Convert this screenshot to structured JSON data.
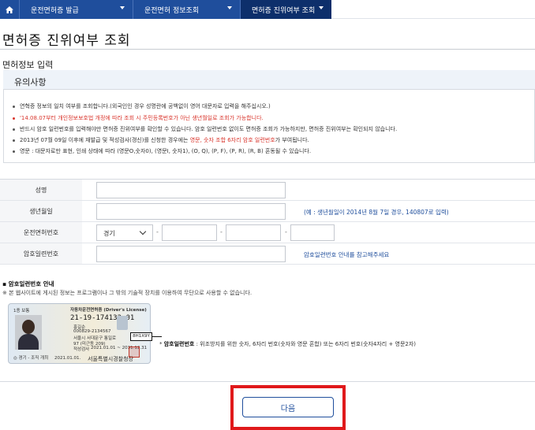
{
  "nav": {
    "items": [
      {
        "label": "운전면허증 발급"
      },
      {
        "label": "운전면허 정보조회"
      },
      {
        "label": "면허증 진위여부 조회"
      }
    ]
  },
  "page": {
    "title": "면허증 진위여부 조회",
    "section": "면허정보 입력"
  },
  "notice": {
    "heading": "유의사항",
    "lines": [
      "연혁증 정보의 일치 여부를 조회합니다.(외국인인 경우 성명란에 공백없이 영어 대문자로 입력을 해주십시오.)",
      "'14.08.07부터 개인정보보호법 개정에 따라 조회 시 주민등록번호가 아닌 생년월일로 조회가 가능합니다.",
      "반드시 암호 일련번호를 입력해야만 면허증 진위여부를 확인할 수 있습니다. 암호 일련번호 없이도 면허증 조회가 가능하지만, 면허증 진위여부는 확인되지 않습니다.",
      "2013년 07월 09일 이후에 재발급 및 적성검사(갱신)를 신청한 경우에는 ",
      "영문, 숫자 조합 6자리 암호 일련번호",
      "가 부여됩니다.",
      "영문 : 대문자로만 표현, 인쇄 상태에 따라 (영문O,숫자0), (영문I, 숫자1), (O, Q), (P, F), (P, R), (R, B) 혼동될 수 있습니다."
    ]
  },
  "form": {
    "name_label": "성명",
    "birth_label": "생년월일",
    "birth_hint": "(예 : 생년월일이 2014년 8월 7일 경우, 140807로 입력)",
    "license_label": "운전면허번호",
    "region_selected": "경기",
    "serial_label": "암호일련번호",
    "serial_hint": "암호일련번호 안내를 참고해주세요"
  },
  "guide": {
    "title": "암호일련번호 안내",
    "desc": "※ 본 웹사이트에 게시된 정보는 프로그램이나 그 밖의 기술적 장치를 이용하여 무단으로 사용할 수 없습니다.",
    "card": {
      "header": "자동차운전면허증",
      "header_en": "(Driver's License)",
      "number": "21-19-174133-01",
      "name": "홍길순",
      "id": "000829-2134567",
      "addr1": "서울시 서대문구 통일로",
      "addr2": "97 (미근동 209)",
      "period_label": "적성검사",
      "period": "2021.01.01 ~ 2031.12.31",
      "issue_date": "2021.01.01.",
      "issuer": "서울특별시경찰청장",
      "serial": "8H1X9Y",
      "left_note": "1종 보통",
      "bottom_note": "◎ 경기 - 조직 개최"
    },
    "caption_bold": "암호일련번호",
    "caption_rest": " : 위조방지를 위한 숫자, 6자리 번호(숫자와 영문 혼합) 또는 6자리 번호(숫자4자리 + 영문2자)"
  },
  "actions": {
    "next": "다음"
  },
  "colors": {
    "nav_bg": "#1f4e9c",
    "nav_active": "#0d2f6b",
    "highlight_red": "#d9352c",
    "annotation_frame": "#e0191b"
  }
}
